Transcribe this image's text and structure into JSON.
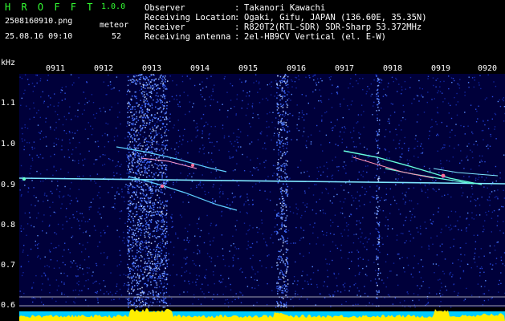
{
  "header": {
    "app_name": "H R O F F T",
    "version": "1.0.0",
    "filename": "2508160910.png",
    "datetime": "25.08.16 09:10",
    "meteor_label": "meteor",
    "meteor_count": "52",
    "info": [
      {
        "key": "Observer",
        "sep": ":",
        "value": "Takanori Kawachi"
      },
      {
        "key": "Receiving Location",
        "sep": ":",
        "value": "Ogaki, Gifu, JAPAN (136.60E, 35.35N)"
      },
      {
        "key": "Receiver",
        "sep": ":",
        "value": "R820T2(RTL-SDR) SDR-Sharp 53.372MHz"
      },
      {
        "key": "Receiving antenna",
        "sep": ":",
        "value": "2el-HB9CV Vertical (el. E-W)"
      }
    ]
  },
  "axes": {
    "y_unit": "kHz",
    "y_ticks": [
      "1.1",
      "1.0",
      "0.9",
      "0.8",
      "0.7",
      "0.6"
    ],
    "x_ticks": [
      "0911",
      "0912",
      "0913",
      "0914",
      "0915",
      "0916",
      "0917",
      "0918",
      "0919",
      "0920"
    ]
  },
  "colors": {
    "background": "#000000",
    "noise": "#1a2aa8",
    "trace": "#66ddff",
    "level_yellow": "#ffee00",
    "level_cyan": "#00ccff",
    "text": "#ffffff",
    "accent": "#33ff33"
  }
}
